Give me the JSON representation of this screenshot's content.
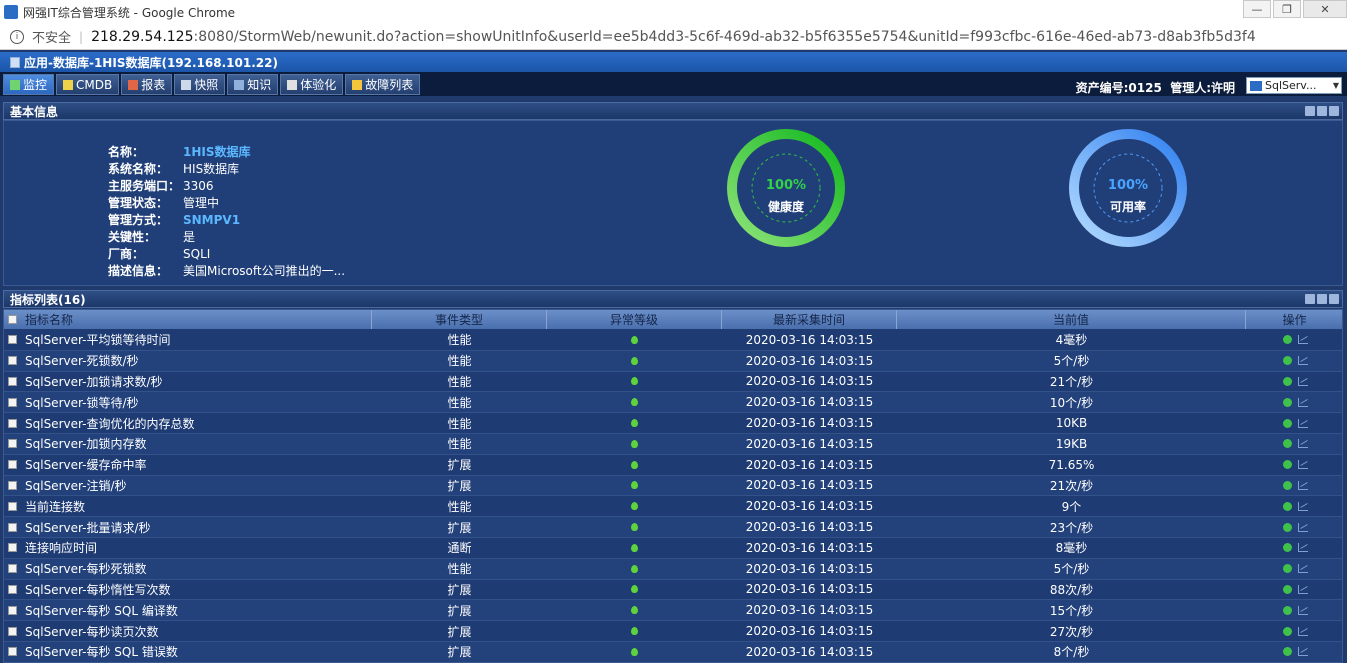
{
  "window": {
    "title": "网强IT综合管理系统 - Google Chrome",
    "address_security": "不安全",
    "url_host": "218.29.54.125",
    "url_rest": ":8080/StormWeb/newunit.do?action=showUnitInfo&userId=ee5b4dd3-5c6f-469d-ab32-b5f6355e5754&unitId=f993cfbc-616e-46ed-ab73-d8ab3fb5d3f4",
    "min_label": "—",
    "max_label": "❐",
    "close_label": "✕"
  },
  "header": {
    "title": "应用-数据库-1HIS数据库(192.168.101.22)"
  },
  "tabs": [
    {
      "label": "监控",
      "active": true
    },
    {
      "label": "CMDB"
    },
    {
      "label": "报表"
    },
    {
      "label": "快照"
    },
    {
      "label": "知识"
    },
    {
      "label": "体验化"
    },
    {
      "label": "故障列表"
    }
  ],
  "right_info": {
    "asset_text": "资产编号:0125",
    "manager_text": "管理人:许明",
    "select_value": "SqlServ..."
  },
  "basic_panel": {
    "title": "基本信息",
    "fields": [
      {
        "label": "名称：",
        "value": "1HIS数据库",
        "link": true
      },
      {
        "label": "系统名称：",
        "value": "HIS数据库"
      },
      {
        "label": "主服务端口：",
        "value": "3306"
      },
      {
        "label": "管理状态：",
        "value": "管理中"
      },
      {
        "label": "管理方式：",
        "value": "SNMPV1",
        "link": true
      },
      {
        "label": "关键性：",
        "value": "是"
      },
      {
        "label": "厂商：",
        "value": "SQLI"
      },
      {
        "label": "描述信息：",
        "value": "美国Microsoft公司推出的一..."
      }
    ],
    "health": {
      "percent": 100,
      "percent_text": "100%",
      "name": "健康度",
      "color": "#27c23a"
    },
    "availability": {
      "percent": 100,
      "percent_text": "100%",
      "name": "可用率",
      "color": "#3d8ef0"
    }
  },
  "metrics_panel": {
    "title": "指标列表(16)",
    "columns": [
      "指标名称",
      "事件类型",
      "异常等级",
      "最新采集时间",
      "当前值",
      "操作"
    ],
    "rows": [
      {
        "name": "SqlServer-平均锁等待时间",
        "type": "性能",
        "time": "2020-03-16 14:03:15",
        "value": "4毫秒"
      },
      {
        "name": "SqlServer-死锁数/秒",
        "type": "性能",
        "time": "2020-03-16 14:03:15",
        "value": "5个/秒"
      },
      {
        "name": "SqlServer-加锁请求数/秒",
        "type": "性能",
        "time": "2020-03-16 14:03:15",
        "value": "21个/秒"
      },
      {
        "name": "SqlServer-锁等待/秒",
        "type": "性能",
        "time": "2020-03-16 14:03:15",
        "value": "10个/秒"
      },
      {
        "name": "SqlServer-查询优化的内存总数",
        "type": "性能",
        "time": "2020-03-16 14:03:15",
        "value": "10KB"
      },
      {
        "name": "SqlServer-加锁内存数",
        "type": "性能",
        "time": "2020-03-16 14:03:15",
        "value": "19KB"
      },
      {
        "name": "SqlServer-缓存命中率",
        "type": "扩展",
        "time": "2020-03-16 14:03:15",
        "value": "71.65%"
      },
      {
        "name": "SqlServer-注销/秒",
        "type": "扩展",
        "time": "2020-03-16 14:03:15",
        "value": "21次/秒"
      },
      {
        "name": "当前连接数",
        "type": "性能",
        "time": "2020-03-16 14:03:15",
        "value": "9个"
      },
      {
        "name": "SqlServer-批量请求/秒",
        "type": "扩展",
        "time": "2020-03-16 14:03:15",
        "value": "23个/秒"
      },
      {
        "name": "连接响应时间",
        "type": "通断",
        "time": "2020-03-16 14:03:15",
        "value": "8毫秒"
      },
      {
        "name": "SqlServer-每秒死锁数",
        "type": "性能",
        "time": "2020-03-16 14:03:15",
        "value": "5个/秒"
      },
      {
        "name": "SqlServer-每秒惰性写次数",
        "type": "扩展",
        "time": "2020-03-16 14:03:15",
        "value": "88次/秒"
      },
      {
        "name": "SqlServer-每秒 SQL 编译数",
        "type": "扩展",
        "time": "2020-03-16 14:03:15",
        "value": "15个/秒"
      },
      {
        "name": "SqlServer-每秒读页次数",
        "type": "扩展",
        "time": "2020-03-16 14:03:15",
        "value": "27次/秒"
      },
      {
        "name": "SqlServer-每秒 SQL 错误数",
        "type": "扩展",
        "time": "2020-03-16 14:03:15",
        "value": "8个/秒"
      }
    ]
  }
}
